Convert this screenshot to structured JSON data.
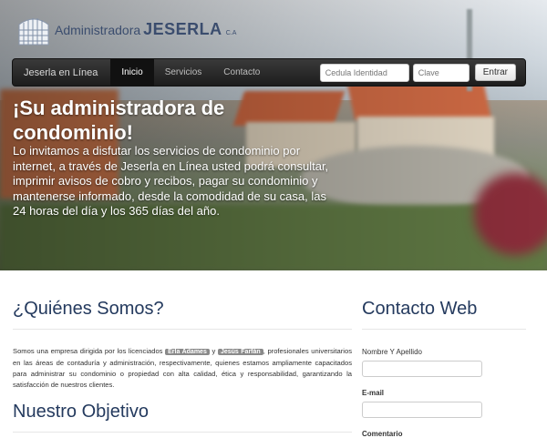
{
  "logo": {
    "admin_text": "Administradora",
    "brand_text": "JESERLA",
    "suffix": "C.A"
  },
  "navbar": {
    "brand": "Jeserla en Línea",
    "items": [
      {
        "label": "Inicio",
        "active": true
      },
      {
        "label": "Servicios",
        "active": false
      },
      {
        "label": "Contacto",
        "active": false
      }
    ],
    "login": {
      "id_placeholder": "Cedula Identidad",
      "password_placeholder": "Clave",
      "submit_label": "Entrar"
    }
  },
  "hero": {
    "title": "¡Su administradora de condominio!",
    "text": "Lo invitamos a disfutar los servicios de condominio por internet, a través de Jeserla en Línea usted podrá consultar, imprimir avisos de cobro y recibos, pagar su condominio y mantenerse informado, desde la comodidad de su casa, las 24 horas del día y los 365 días del año."
  },
  "about": {
    "heading": "¿Quiénes Somos?",
    "text_before": "Somos una empresa dirigida por los licenciados ",
    "name1": "Erla Adames",
    "connector": " y ",
    "name2": "Jesús Farfán",
    "text_after": ", profesionales universitarios en las áreas de contaduría y administración, respectivamente, quienes estamos ampliamente capacitados para administrar su condominio o propiedad con alta calidad, ética y responsabilidad, garantizando la satisfacción de nuestros clientes."
  },
  "objective": {
    "heading": "Nuestro Objetivo"
  },
  "contact": {
    "heading": "Contacto Web",
    "name_label": "Nombre Y Apellido",
    "email_label": "E-mail",
    "comment_label": "Comentario"
  },
  "colors": {
    "heading": "#243a5e",
    "navbar": "#1d1d1d",
    "tag": "#8a8a8a"
  }
}
